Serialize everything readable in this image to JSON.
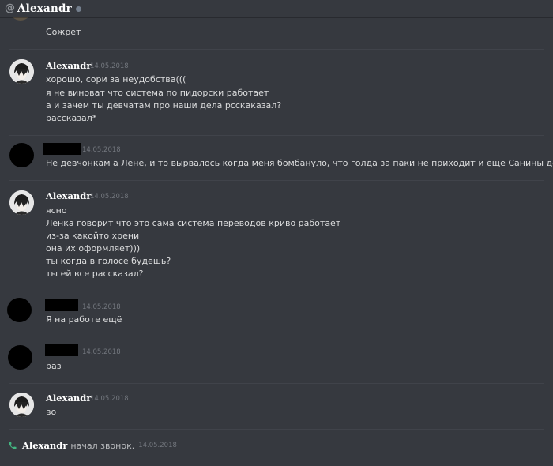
{
  "header": {
    "at_symbol": "@",
    "title": "Alexandr",
    "status": "offline"
  },
  "messages": [
    {
      "author": "",
      "redacted": true,
      "avatar": "partial",
      "time": "",
      "lines": [
        "Сожрет"
      ]
    },
    {
      "author": "Alexandr",
      "redacted": false,
      "avatar": "anime-avatar",
      "time": "14.05.2018",
      "lines": [
        "хорошо, сори за неудобства(((",
        "я не виноват что система по пидорски работает",
        "а и зачем ты девчатам про наши дела рсскаказал?",
        "рассказал*"
      ]
    },
    {
      "author": "",
      "redacted": true,
      "avatar": "black-avatar",
      "time": "14.05.2018",
      "lines": [
        "Не девчонкам а Лене, и то вырвалось когда меня бомбануло, что голда за паки не приходит и ещё Санины деньги не приходят"
      ]
    },
    {
      "author": "Alexandr",
      "redacted": false,
      "avatar": "anime-avatar",
      "time": "14.05.2018",
      "lines": [
        "ясно",
        "Ленка говорит что это сама система переводов криво работает",
        "из-за какойто хрени",
        "она их оформляет)))",
        "ты когда в голосе будешь?",
        "ты ей все рассказал?"
      ]
    },
    {
      "author": "",
      "redacted": true,
      "avatar": "black-avatar",
      "time": "14.05.2018",
      "lines": [
        "Я на работе ещё"
      ]
    },
    {
      "author": "",
      "redacted": true,
      "avatar": "black-avatar",
      "time": "14.05.2018",
      "lines": [
        "раз"
      ]
    },
    {
      "author": "Alexandr",
      "redacted": false,
      "avatar": "anime-avatar",
      "time": "14.05.2018",
      "lines": [
        "во"
      ]
    }
  ],
  "call_event": {
    "icon": "phone-icon",
    "user": "Alexandr",
    "text": "начал звонок.",
    "time": "14.05.2018"
  },
  "colors": {
    "background": "#36393f",
    "text": "#dcddde",
    "username": "#ffffff",
    "timestamp": "#72767d",
    "phone_green": "#43b581"
  }
}
